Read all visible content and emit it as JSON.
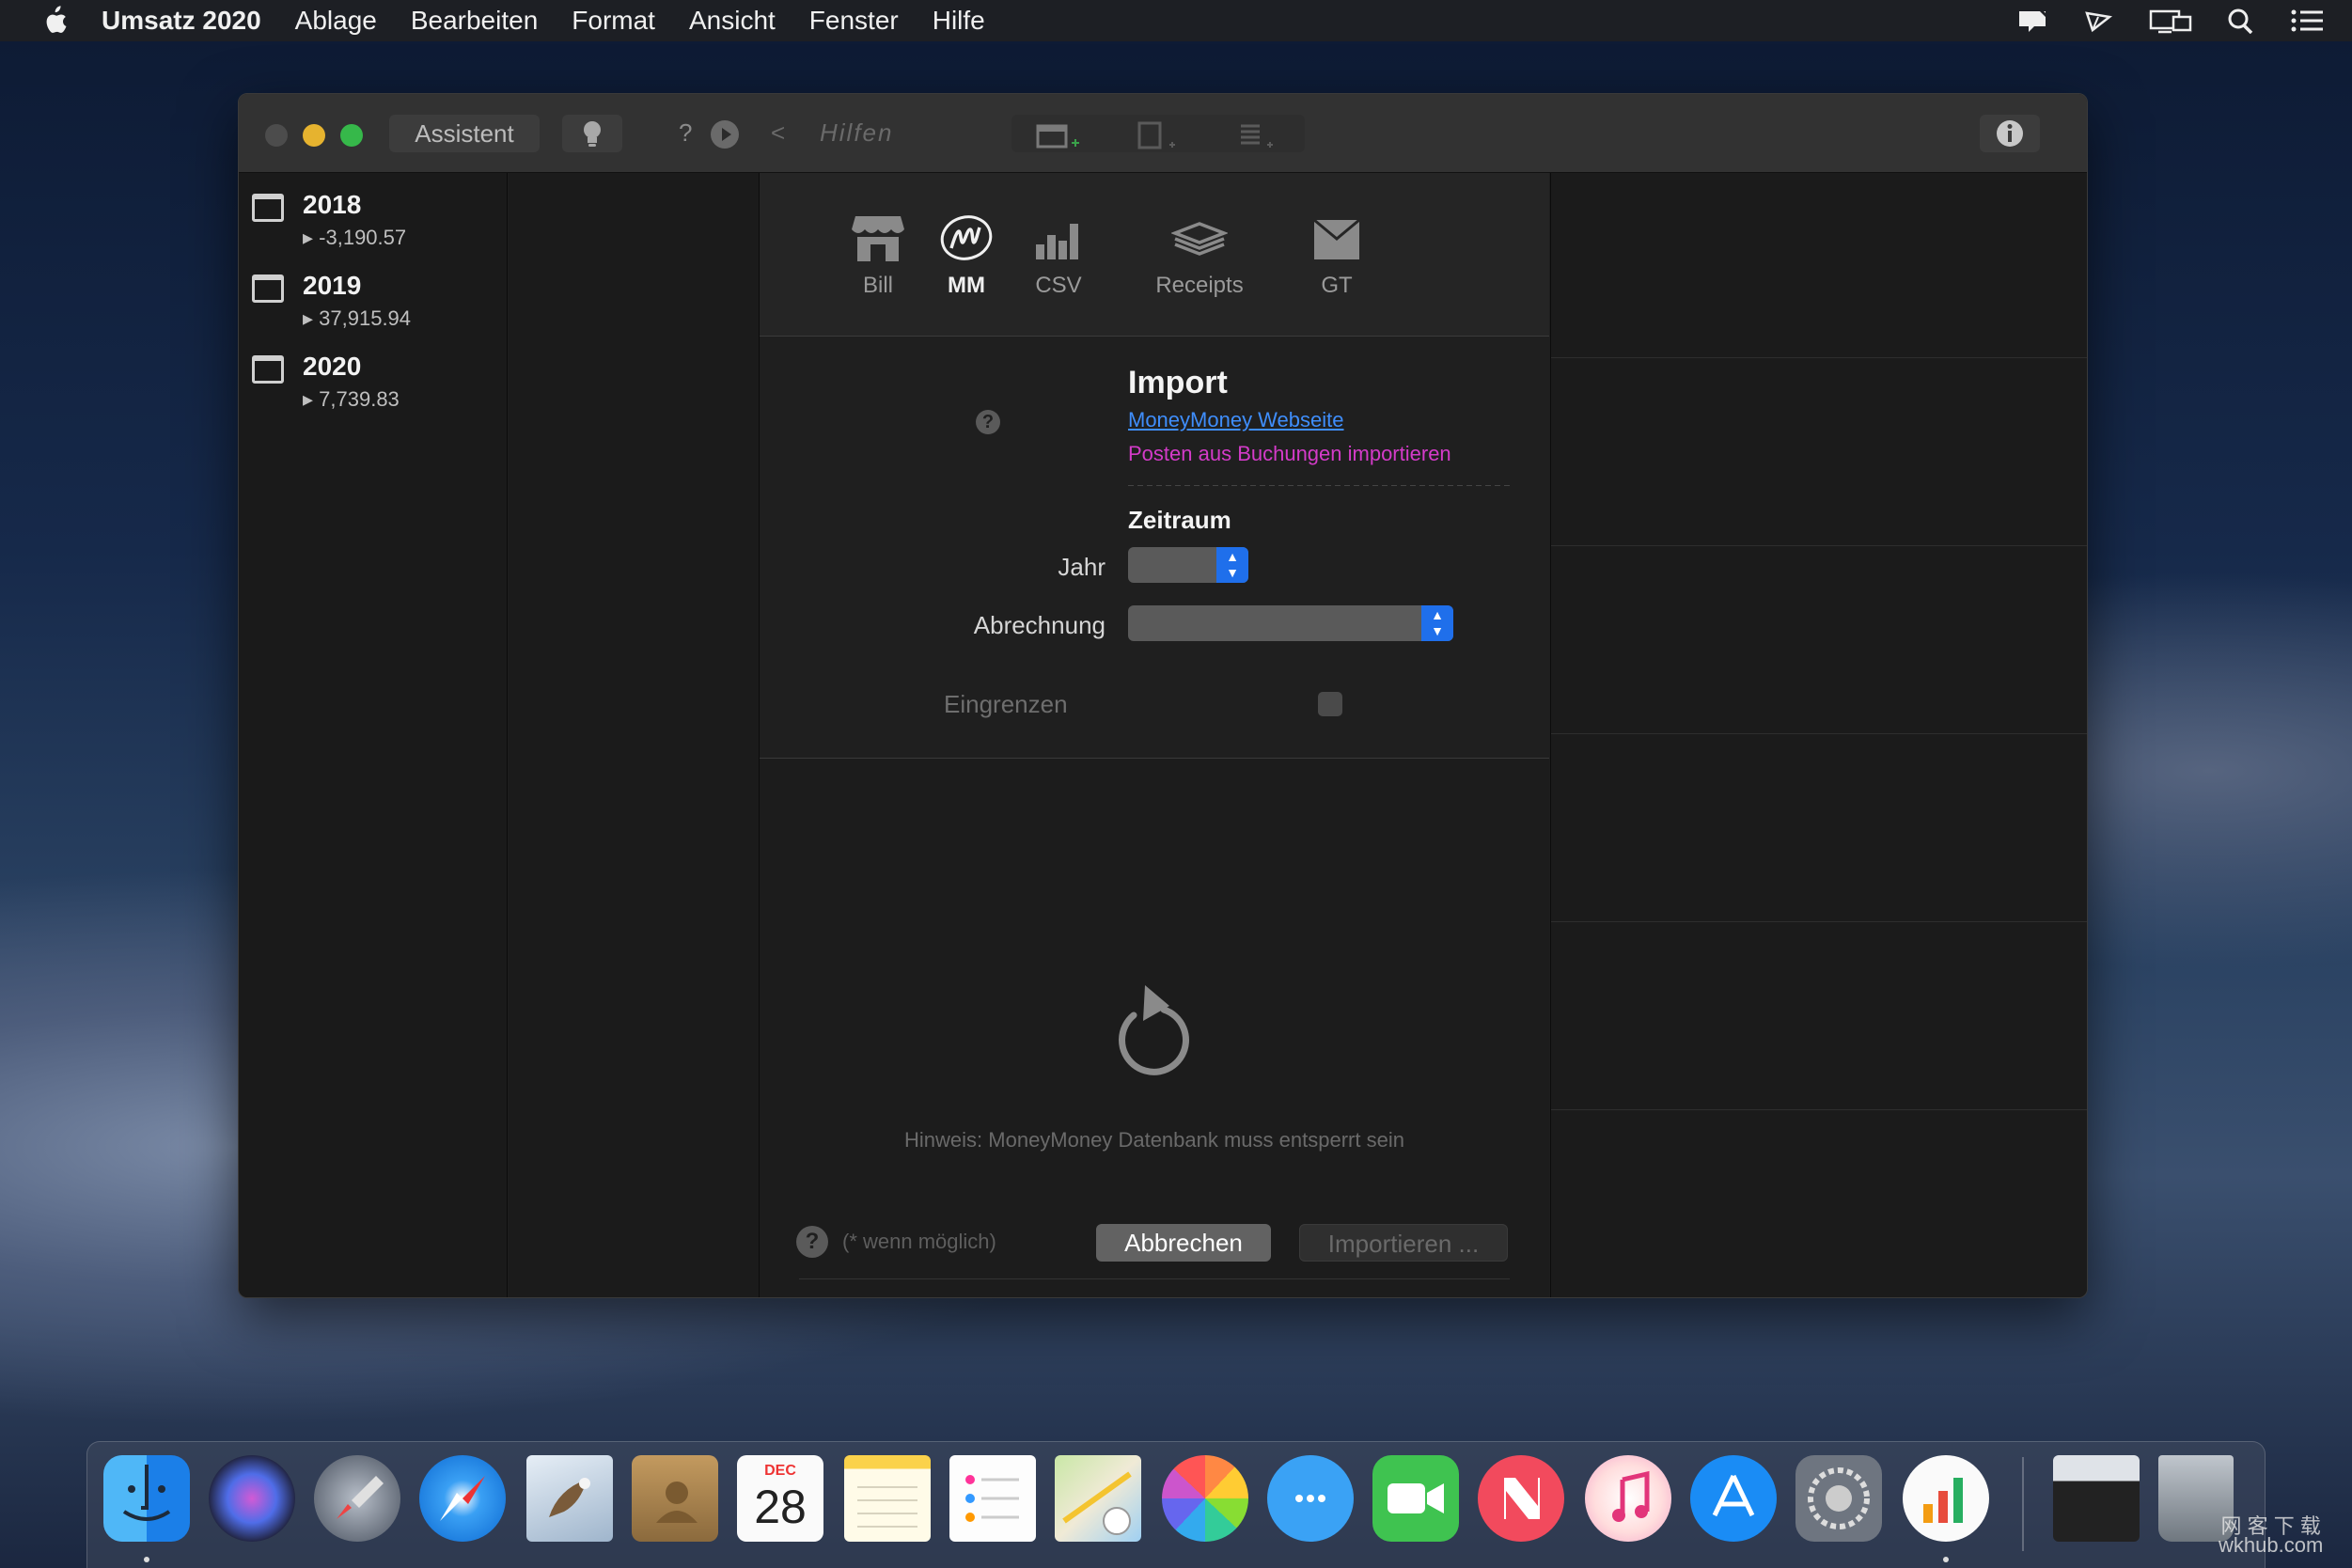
{
  "menubar": {
    "app_name": "Umsatz 2020",
    "items": [
      "Ablage",
      "Bearbeiten",
      "Format",
      "Ansicht",
      "Fenster",
      "Hilfe"
    ],
    "status_icons": [
      "notification-icon",
      "airdrop-icon",
      "display-icon",
      "search-icon",
      "list-icon"
    ]
  },
  "toolbar": {
    "assistant_label": "Assistent",
    "help_mark": "?",
    "back_glyph": "<",
    "help_label": "Hilfen"
  },
  "sidebar": {
    "years": [
      {
        "year": "2018",
        "total": "▸ -3,190.57"
      },
      {
        "year": "2019",
        "total": "▸ 37,915.94"
      },
      {
        "year": "2020",
        "total": "▸ 7,739.83"
      }
    ]
  },
  "import_tabs": [
    {
      "label": "Bill",
      "icon": "store-icon"
    },
    {
      "label": "MM",
      "icon": "moneymoney-icon"
    },
    {
      "label": "CSV",
      "icon": "bar-chart-icon"
    },
    {
      "label": "Receipts",
      "icon": "stack-icon"
    },
    {
      "label": "GT",
      "icon": "envelope-icon"
    }
  ],
  "import_section": {
    "title": "Import",
    "help_mark": "?",
    "link": "MoneyMoney Webseite",
    "subtitle": "Posten aus Buchungen importieren"
  },
  "period": {
    "title": "Zeitraum",
    "year_label": "Jahr",
    "year_value": "",
    "billing_label": "Abrechnung",
    "billing_value": "",
    "restrict_label": "Eingrenzen"
  },
  "hint": "Hinweis: MoneyMoney Datenbank muss entsperrt sein",
  "footer": {
    "help_mark": "?",
    "note": "(* wenn möglich)",
    "cancel_label": "Abbrechen",
    "import_label": "Importieren ..."
  },
  "dock": {
    "apps": [
      "finder",
      "siri",
      "launchpad",
      "safari",
      "mail",
      "contacts",
      "calendar",
      "notes",
      "reminders",
      "maps",
      "photos",
      "messages",
      "facetime",
      "news",
      "music",
      "app-store",
      "system-preferences",
      "umsatz",
      "downloads",
      "trash"
    ],
    "calendar_month": "DEC",
    "calendar_day": "28"
  },
  "watermark": {
    "line1": "网 客 下 载",
    "line2": "wkhub.com"
  },
  "colors": {
    "accent": "#1f6feb",
    "link": "#3f8efc",
    "magenta": "#d43bc9",
    "traffic_close": "#4c4c4c",
    "traffic_min": "#e6b32f",
    "traffic_max": "#36b84a"
  }
}
